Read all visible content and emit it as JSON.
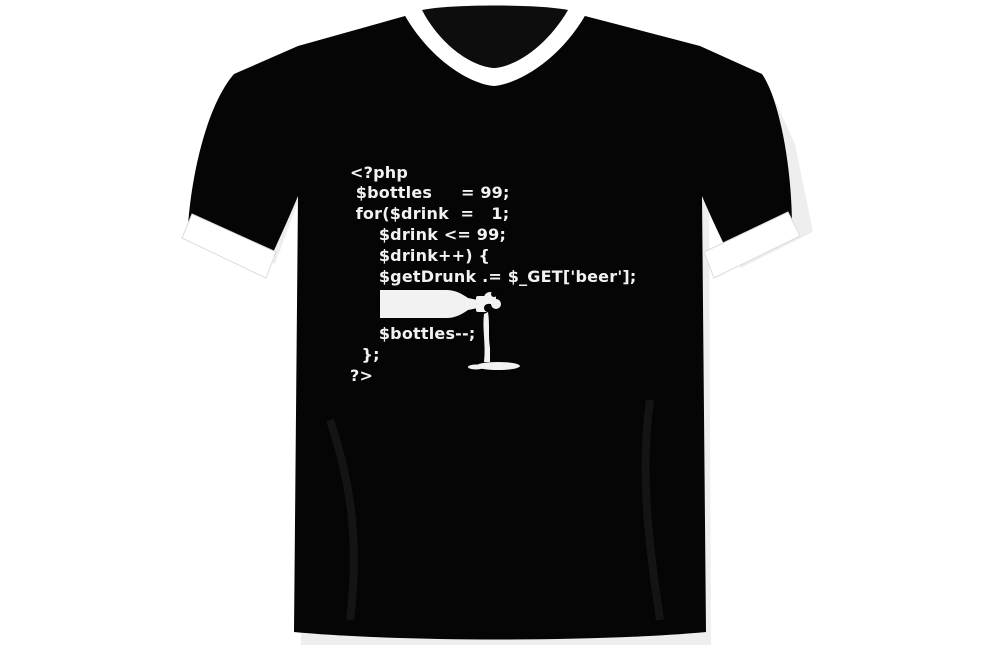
{
  "image": {
    "subject": "tshirt",
    "shirt_color": "#000000",
    "trim_color": "#ffffff",
    "print_color": "#f2f2f2"
  },
  "print": {
    "code_lines": [
      "<?php",
      " $bottles     = 99;",
      " for($drink  =   1;",
      "     $drink <= 99;",
      "     $drink++) {",
      "     $getDrunk .= $_GET['beer'];",
      "     $bottles--;",
      "  };",
      "?>"
    ],
    "graphic": "pouring-bottle-icon"
  }
}
